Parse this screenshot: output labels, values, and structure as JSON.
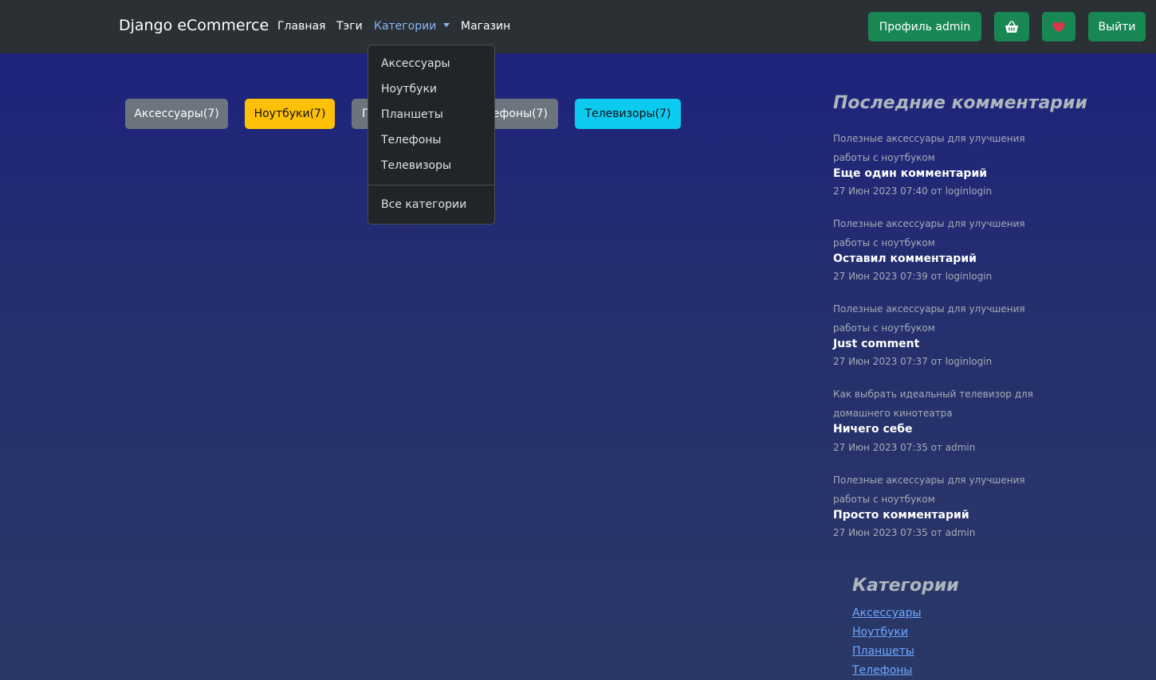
{
  "navbar": {
    "brand": "Django eCommerce",
    "links": [
      "Главная",
      "Тэги",
      "Категории",
      "Магазин"
    ],
    "profile_button": "Профиль admin",
    "logout_button": "Выйти",
    "cart_icon": "basket-icon",
    "favorites_icon": "heart-icon"
  },
  "chips": [
    {
      "label": "Аксессуары(7)",
      "color": "#6c757d"
    },
    {
      "label": "Ноутбуки(7)",
      "color": "#ffc107"
    },
    {
      "label": "Планшеты(7)",
      "color": "#6c757d"
    },
    {
      "label": "Телефоны(7)",
      "color": "#6c757d"
    },
    {
      "label": "Телевизоры(7)",
      "color": "#0dcaf0"
    }
  ],
  "dropdown": {
    "items": [
      "Аксессуары",
      "Ноутбуки",
      "Планшеты",
      "Телефоны",
      "Телевизоры"
    ],
    "all_label": "Все категории"
  },
  "comments": {
    "title": "Последние комментарии",
    "items": [
      {
        "post": "Полезные аксессуары для улучшения работы с ноутбуком",
        "body": "Еще один комментарий",
        "meta": "27 Июн 2023 07:40 от loginlogin"
      },
      {
        "post": "Полезные аксессуары для улучшения работы с ноутбуком",
        "body": "Оставил комментарий",
        "meta": "27 Июн 2023 07:39 от loginlogin"
      },
      {
        "post": "Полезные аксессуары для улучшения работы с ноутбуком",
        "body": "Just comment",
        "meta": "27 Июн 2023 07:37 от loginlogin"
      },
      {
        "post": "Как выбрать идеальный телевизор для домашнего кинотеатра",
        "body": "Ничего себе",
        "meta": "27 Июн 2023 07:35 от admin"
      },
      {
        "post": "Полезные аксессуары для улучшения работы с ноутбуком",
        "body": "Просто комментарий",
        "meta": "27 Июн 2023 07:35 от admin"
      }
    ]
  },
  "categories": {
    "title": "Категории",
    "links": [
      "Аксессуары",
      "Ноутбуки",
      "Планшеты",
      "Телефоны"
    ]
  },
  "colors": {
    "navbar_bg": "#2b3035",
    "success_green": "#198754",
    "heart_red": "#dc3545",
    "link_blue": "#6ea8fe"
  }
}
